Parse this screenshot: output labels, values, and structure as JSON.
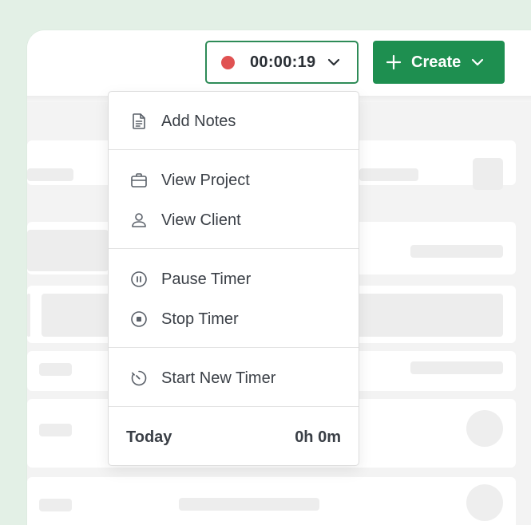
{
  "header": {
    "timer": {
      "time": "00:00:19",
      "recording_color": "#e05252",
      "icons": [
        "record-dot-icon",
        "chevron-down-icon"
      ]
    },
    "create": {
      "label": "Create",
      "color": "#1e8f50",
      "icons": [
        "plus-icon",
        "chevron-down-icon"
      ]
    }
  },
  "menu": {
    "items": [
      {
        "label": "Add Notes",
        "icon": "document-icon"
      },
      {
        "label": "View Project",
        "icon": "briefcase-icon"
      },
      {
        "label": "View Client",
        "icon": "user-icon"
      },
      {
        "label": "Pause Timer",
        "icon": "pause-circle-icon"
      },
      {
        "label": "Stop Timer",
        "icon": "stop-circle-icon"
      },
      {
        "label": "Start New Timer",
        "icon": "stopwatch-icon"
      }
    ],
    "footer": {
      "label": "Today",
      "value": "0h 0m"
    }
  }
}
